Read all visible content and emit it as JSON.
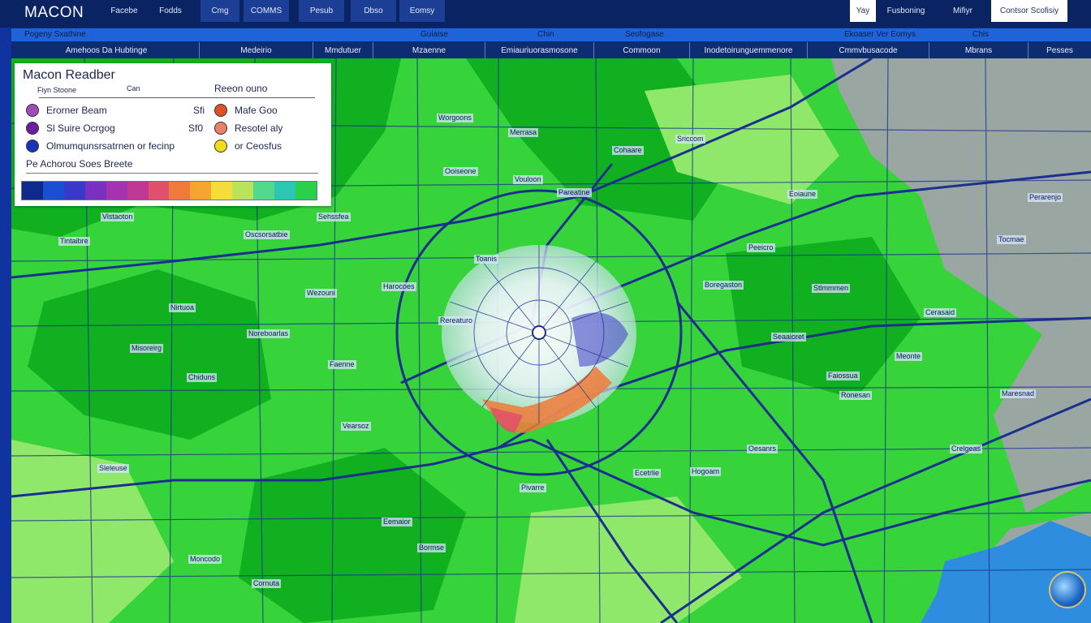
{
  "header": {
    "brand": "MACON",
    "tabs": [
      "Facebe",
      "Fodds",
      "Cmg",
      "COMMS",
      "Pesub",
      "Dbso",
      "Eomsy"
    ],
    "right_tabs": [
      "Yay",
      "Fusboning",
      "Mifiyr"
    ],
    "right_button": "Contsor Scofisiy"
  },
  "subbar": [
    "Pogeny Sxathine",
    "Guiaise",
    "Chin",
    "Seofogase",
    "Ekoaser Ver Eomys",
    "Chis"
  ],
  "categories": [
    "Amehoos Da Hubtinge",
    "Medeirio",
    "Mmdutuer",
    "Mzaenne",
    "Emiauriuorasmosone",
    "Commoon",
    "Inodetoirunguemmenore",
    "Cmmvbusacode",
    "Mbrans",
    "Pesses"
  ],
  "legend": {
    "title": "Macon Readber",
    "sub_left": "Fiyn Stoone",
    "sub_mid": "Can",
    "right_header": "Reeon ouno",
    "items_left": [
      {
        "label": "Erorner Beam",
        "color": "#9b4db8"
      },
      {
        "label": "Sl Suire Ocrgog",
        "color": "#6a1fa0"
      },
      {
        "label": "Olmumqunsrsatrnen or fecinp",
        "color": "#1932b8"
      }
    ],
    "items_values": [
      "Sfi",
      "Sf0"
    ],
    "items_right": [
      {
        "label": "Mafe Goo",
        "color": "#e2502a"
      },
      {
        "label": "Resotel aly",
        "color": "#e9806a"
      },
      {
        "label": "or Ceosfus",
        "color": "#f1dd14"
      }
    ],
    "footer": "Pe Achorou Soes Breete",
    "scale_colors": [
      "#0f2a8c",
      "#1b4fd1",
      "#3a38c8",
      "#7a30c0",
      "#a532b0",
      "#c03894",
      "#e0506a",
      "#f07a3a",
      "#f6a630",
      "#f4dc3c",
      "#b8e35a",
      "#52d98c",
      "#2cc7b0",
      "#2bd04a"
    ]
  },
  "map": {
    "colors": {
      "green": "#36d43a",
      "light_green": "#8fe86a",
      "dark_green": "#10b020",
      "gray": "#9aa6a2",
      "water": "#2f8de0",
      "road": "#1b2f8e"
    },
    "places": [
      "Vistaoton",
      "Sehssfea",
      "Tintaibre",
      "Oscsorsatbie",
      "Nirtuoa",
      "Wezouni",
      "Misoreirg",
      "Noreboarlas",
      "Faenne",
      "Chiduns",
      "Harocoes",
      "Rereaturo",
      "Toanis",
      "Vouloon",
      "Pareatine",
      "Ooiseone",
      "Worgoons",
      "Merrasa",
      "Cohaare",
      "Sriccom",
      "Eoiaune",
      "Peeicro",
      "Boregaston",
      "Stlmmmen",
      "Cerasaid",
      "Meonte",
      "Tocmae",
      "Perarenjo",
      "Faiossua",
      "Ronesan",
      "Maresnad",
      "Seaaioret",
      "Crelgeas",
      "Oesanrs",
      "Hogoam",
      "Ecetrlie",
      "Pivarre",
      "Eemaior",
      "Bormse",
      "Vearsoz",
      "Moncodo",
      "Sleleuse",
      "Cornuta"
    ]
  }
}
